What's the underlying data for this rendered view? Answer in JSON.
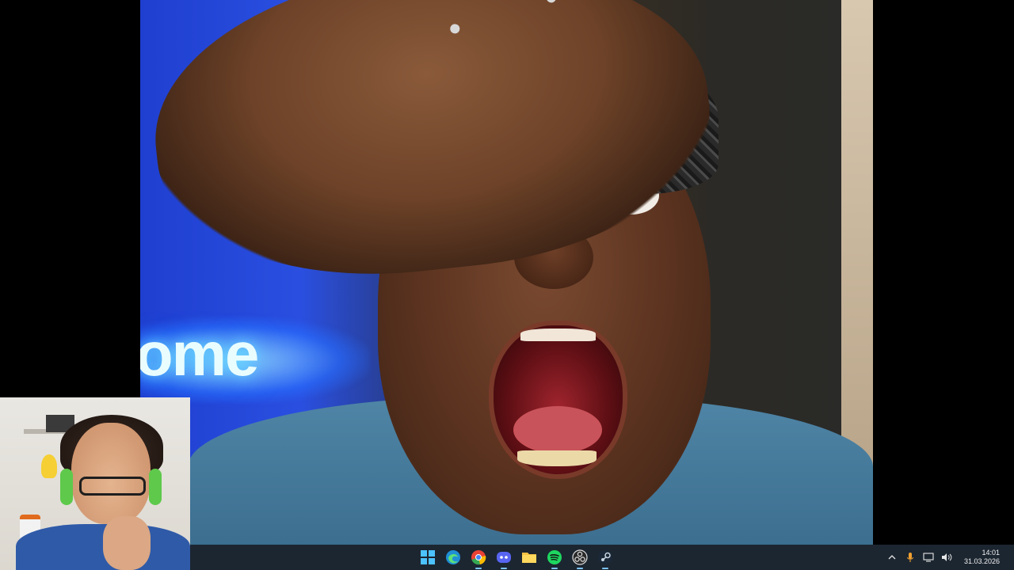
{
  "viewer": {
    "neon_text": "ome"
  },
  "taskbar": {
    "apps": [
      {
        "name": "Start",
        "icon": "windows-start-icon",
        "color": "#4cc2ff"
      },
      {
        "name": "Microsoft Edge",
        "icon": "edge-icon",
        "color": "#2fb3d8"
      },
      {
        "name": "Google Chrome",
        "icon": "chrome-icon",
        "color": "#e94235"
      },
      {
        "name": "Discord",
        "icon": "discord-icon",
        "color": "#5865f2"
      },
      {
        "name": "File Explorer",
        "icon": "folder-icon",
        "color": "#f6c244"
      },
      {
        "name": "Spotify",
        "icon": "spotify-icon",
        "color": "#1ed760"
      },
      {
        "name": "OBS Studio",
        "icon": "obs-icon",
        "color": "#ffffff"
      },
      {
        "name": "Steam",
        "icon": "steam-icon",
        "color": "#9fd0f0"
      }
    ],
    "tray": {
      "time": "14:01",
      "date": "31.03.2026"
    }
  }
}
